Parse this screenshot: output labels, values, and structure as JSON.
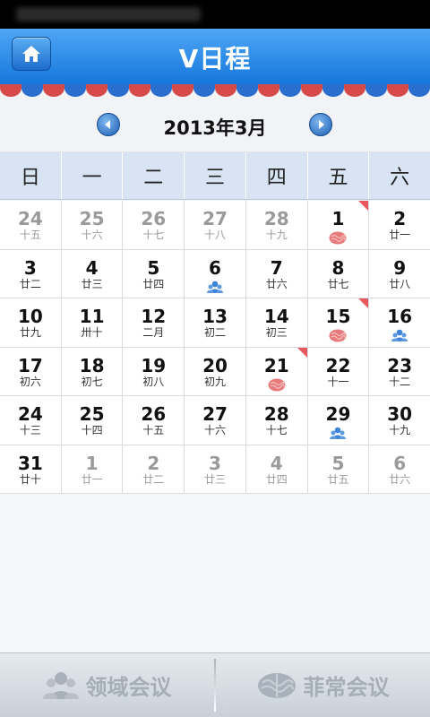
{
  "app": {
    "title": "V日程"
  },
  "calendar": {
    "month_label": "2013年3月",
    "weekdays": [
      "日",
      "一",
      "二",
      "三",
      "四",
      "五",
      "六"
    ],
    "colors": {
      "marker": "#e8585f",
      "accent": "#1577dc"
    },
    "weeks": [
      [
        {
          "day": "24",
          "lunar": "十五",
          "other": true
        },
        {
          "day": "25",
          "lunar": "十六",
          "other": true
        },
        {
          "day": "26",
          "lunar": "十七",
          "other": true
        },
        {
          "day": "27",
          "lunar": "十八",
          "other": true
        },
        {
          "day": "28",
          "lunar": "十九",
          "other": true
        },
        {
          "day": "1",
          "lunar": "",
          "marker": true,
          "icon": "brain-icon"
        },
        {
          "day": "2",
          "lunar": "廿一"
        }
      ],
      [
        {
          "day": "3",
          "lunar": "廿二"
        },
        {
          "day": "4",
          "lunar": "廿三"
        },
        {
          "day": "5",
          "lunar": "廿四"
        },
        {
          "day": "6",
          "lunar": "",
          "icon": "people-icon"
        },
        {
          "day": "7",
          "lunar": "廿六"
        },
        {
          "day": "8",
          "lunar": "廿七"
        },
        {
          "day": "9",
          "lunar": "廿八"
        }
      ],
      [
        {
          "day": "10",
          "lunar": "廿九"
        },
        {
          "day": "11",
          "lunar": "卅十"
        },
        {
          "day": "12",
          "lunar": "二月"
        },
        {
          "day": "13",
          "lunar": "初二"
        },
        {
          "day": "14",
          "lunar": "初三"
        },
        {
          "day": "15",
          "lunar": "",
          "marker": true,
          "icon": "brain-icon"
        },
        {
          "day": "16",
          "lunar": "",
          "icon": "people-icon"
        }
      ],
      [
        {
          "day": "17",
          "lunar": "初六"
        },
        {
          "day": "18",
          "lunar": "初七"
        },
        {
          "day": "19",
          "lunar": "初八"
        },
        {
          "day": "20",
          "lunar": "初九"
        },
        {
          "day": "21",
          "lunar": "",
          "marker": true,
          "icon": "brain-icon"
        },
        {
          "day": "22",
          "lunar": "十一"
        },
        {
          "day": "23",
          "lunar": "十二"
        }
      ],
      [
        {
          "day": "24",
          "lunar": "十三"
        },
        {
          "day": "25",
          "lunar": "十四"
        },
        {
          "day": "26",
          "lunar": "十五"
        },
        {
          "day": "27",
          "lunar": "十六"
        },
        {
          "day": "28",
          "lunar": "十七"
        },
        {
          "day": "29",
          "lunar": "",
          "icon": "people-icon"
        },
        {
          "day": "30",
          "lunar": "十九"
        }
      ],
      [
        {
          "day": "31",
          "lunar": "廿十"
        },
        {
          "day": "1",
          "lunar": "廿一",
          "other": true
        },
        {
          "day": "2",
          "lunar": "廿二",
          "other": true
        },
        {
          "day": "3",
          "lunar": "廿三",
          "other": true
        },
        {
          "day": "4",
          "lunar": "廿四",
          "other": true
        },
        {
          "day": "5",
          "lunar": "廿五",
          "other": true
        },
        {
          "day": "6",
          "lunar": "廿六",
          "other": true
        }
      ]
    ]
  },
  "footer": {
    "domain_meeting": {
      "label": "领域会议",
      "icon": "people-icon"
    },
    "special_meeting": {
      "label": "菲常会议",
      "icon": "brain-icon"
    }
  }
}
